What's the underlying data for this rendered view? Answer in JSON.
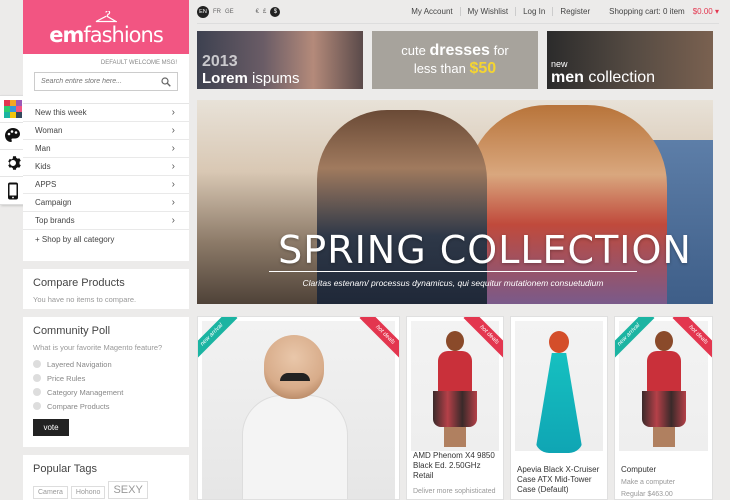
{
  "brand": {
    "part1": "em",
    "part2": "fashions"
  },
  "welcome": "DEFAULT WELCOME MSG!",
  "search": {
    "placeholder": "Search entire store here..."
  },
  "nav": {
    "items": [
      {
        "label": "New this week"
      },
      {
        "label": "Woman"
      },
      {
        "label": "Man"
      },
      {
        "label": "Kids"
      },
      {
        "label": "APPS"
      },
      {
        "label": "Campaign"
      },
      {
        "label": "Top brands"
      }
    ],
    "shop_all": "+ Shop by all category"
  },
  "compare": {
    "title": "Compare Products",
    "note": "You have no items to compare."
  },
  "poll": {
    "title": "Community Poll",
    "question": "What is your favorite Magento feature?",
    "options": [
      "Layered Navigation",
      "Price Rules",
      "Category Management",
      "Compare Products"
    ],
    "vote_label": "vote"
  },
  "tags": {
    "title": "Popular Tags",
    "items": [
      "Camera",
      "Hohono",
      "SEXY"
    ]
  },
  "topbar": {
    "languages": [
      "EN",
      "FR",
      "GE"
    ],
    "currencies": [
      "€",
      "£",
      "$"
    ],
    "links": [
      "My Account",
      "My Wishlist",
      "Log In",
      "Register"
    ],
    "cart_label": "Shopping cart: 0 item",
    "cart_total": "$0.00 ▾"
  },
  "banners": {
    "b1": {
      "year": "2013",
      "word1": "Lorem",
      "word2": "ispums"
    },
    "b2": {
      "line1a": "cute",
      "line1b": "dresses",
      "line1c": "for",
      "line2a": "less than",
      "line2b": "$50"
    },
    "b3": {
      "line1": "new",
      "line2a": "men",
      "line2b": "collection"
    }
  },
  "hero": {
    "title": "SPRING COLLECTION",
    "subtitle": "Claritas estenam/ processus dynamicus, qui sequitur mutationem consuetudium"
  },
  "products": [
    {
      "ribbon_new": "new arrival",
      "ribbon_hot": "hot deals"
    },
    {
      "ribbon_hot": "hot deals",
      "name": "AMD Phenom X4 9850 Black Ed. 2.50GHz Retail",
      "desc": "Deliver more sophisticated"
    },
    {
      "name": "Apevia Black X-Cruiser Case ATX Mid-Tower Case (Default)",
      "desc": ""
    },
    {
      "ribbon_new": "new arrival",
      "ribbon_hot": "hot deals",
      "name": "Computer",
      "desc": "Make a computer",
      "price": "Regular $463.00"
    }
  ],
  "colors": {
    "brand_pink": "#f25582",
    "hot_red": "#e3364f",
    "new_teal": "#1bb4a2",
    "accent_yellow": "#f5d531"
  }
}
